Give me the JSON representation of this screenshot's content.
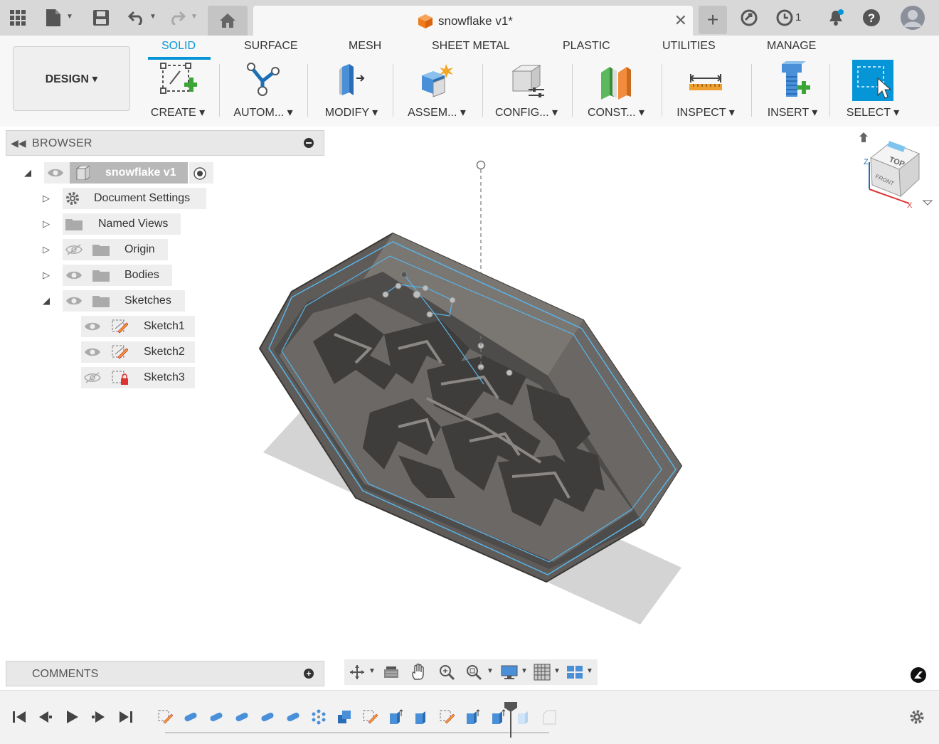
{
  "app": {
    "document_title": "snowflake v1*",
    "jobs_count": "1"
  },
  "ribbon": {
    "workspace_button": "DESIGN ▾",
    "tabs": [
      "SOLID",
      "SURFACE",
      "MESH",
      "SHEET METAL",
      "PLASTIC",
      "UTILITIES",
      "MANAGE"
    ],
    "active_tab": "SOLID",
    "groups": [
      "CREATE ▾",
      "AUTOM... ▾",
      "MODIFY ▾",
      "ASSEM... ▾",
      "CONFIG... ▾",
      "CONST... ▾",
      "INSPECT ▾",
      "INSERT ▾",
      "SELECT ▾"
    ]
  },
  "browser": {
    "title": "BROWSER",
    "root": "snowflake v1",
    "items": [
      "Document Settings",
      "Named Views",
      "Origin",
      "Bodies",
      "Sketches"
    ],
    "sketches": [
      "Sketch1",
      "Sketch2",
      "Sketch3"
    ]
  },
  "comments": {
    "title": "COMMENTS"
  },
  "viewcube": {
    "top": "TOP",
    "front": "FRONT",
    "axis_z": "Z",
    "axis_x": "X"
  },
  "icons": {
    "accent": "#0696d7",
    "body_color": "#6e6a66"
  }
}
